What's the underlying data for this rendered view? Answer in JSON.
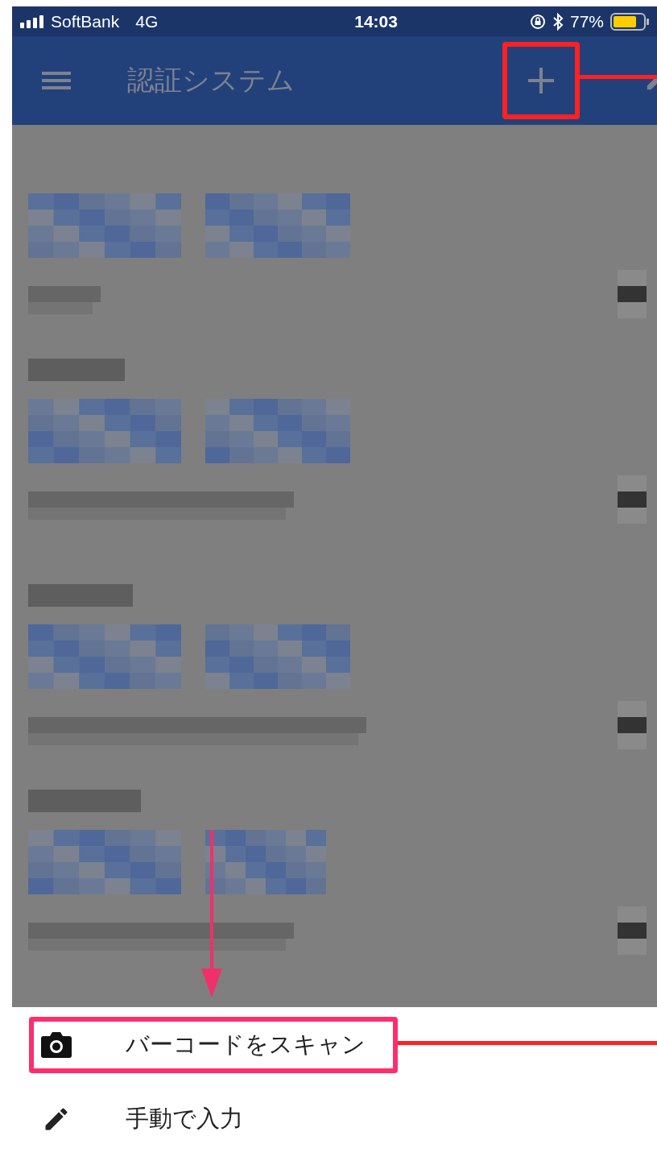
{
  "status_bar": {
    "carrier": "SoftBank",
    "network": "4G",
    "time": "14:03",
    "battery": "77%"
  },
  "app_bar": {
    "title": "認証システム",
    "add_highlighted": true
  },
  "sheet": {
    "items": [
      {
        "kind": "camera",
        "label": "バーコードをスキャン",
        "highlighted": true
      },
      {
        "kind": "pencil",
        "label": "手動で入力",
        "highlighted": false
      }
    ]
  }
}
